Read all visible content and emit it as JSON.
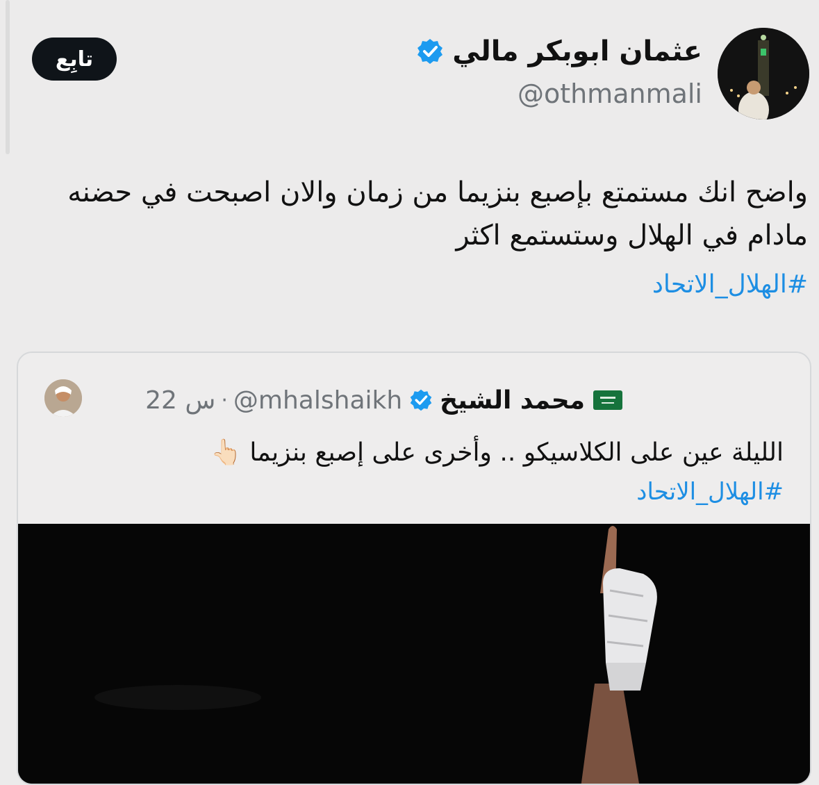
{
  "tweet": {
    "author_name": "عثمان ابوبكر مالي",
    "author_handle": "@othmanmali",
    "follow_label": "تابِع",
    "text": "واضح انك مستمتع بإصبع بنزيما من زمان والان اصبحت في حضنه مادام في الهلال وستستمع اكثر",
    "hashtag": "#الهلال_الاتحاد"
  },
  "quoted": {
    "time": "22 س",
    "separator": "·",
    "handle": "@mhalshaikh",
    "name": "محمد الشيخ",
    "text": "الليلة عين على الكلاسيكو .. وأخرى على إصبع بنزيما 👆🏻",
    "hashtag": "#الهلال_الاتحاد"
  },
  "icons": [
    "verified-badge-icon",
    "saudi-flag-icon"
  ],
  "colors": {
    "link": "#1d8ee3",
    "verified": "#1d9bf0",
    "button_bg": "#0f1419",
    "muted": "#6f7479"
  }
}
